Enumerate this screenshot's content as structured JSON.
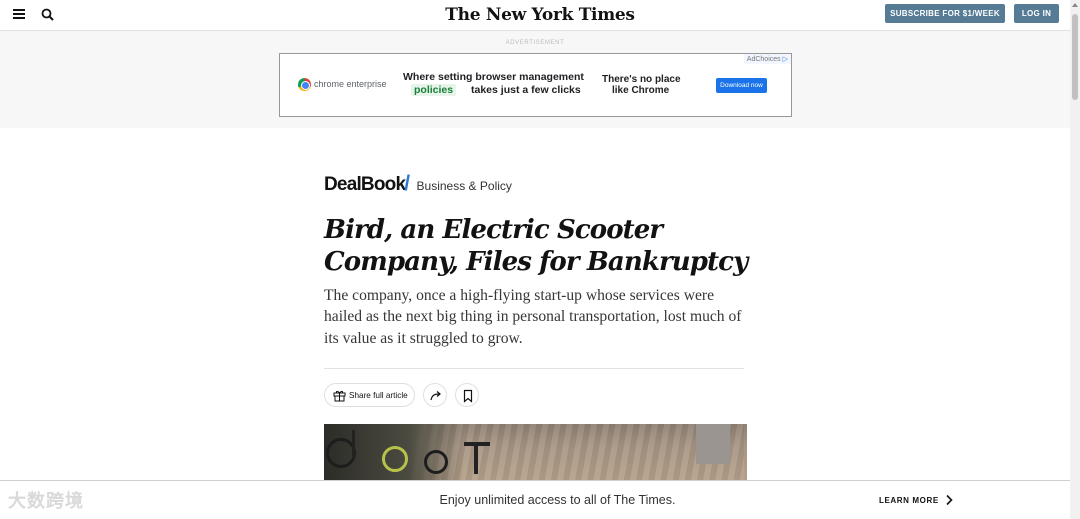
{
  "header": {
    "logo": "The New York Times",
    "subscribe_label": "SUBSCRIBE FOR $1/WEEK",
    "login_label": "LOG IN"
  },
  "ad": {
    "label": "ADVERTISEMENT",
    "adchoices": "AdChoices",
    "brand": "chrome enterprise",
    "headline_1": "Where setting browser management",
    "headline_highlight": "policies",
    "headline_2": "takes just a few clicks",
    "tagline_1": "There's no place",
    "tagline_2": "like Chrome",
    "cta": "Download now"
  },
  "article": {
    "column": "DealBook",
    "section": "Business & Policy",
    "headline": "Bird, an Electric Scooter Company, Files for Bankruptcy",
    "summary": "The company, once a high-flying start-up whose services were hailed as the next big thing in personal transportation, lost much of its value as it struggled to grow.",
    "share_label": "Share full article"
  },
  "bottom_bar": {
    "watermark": "大数跨境",
    "promo_text": "Enjoy unlimited access to all of The Times.",
    "learn_more_label": "LEARN MORE"
  },
  "icons": [
    "menu-icon",
    "search-icon",
    "gift-icon",
    "share-icon",
    "bookmark-icon",
    "chevron-right-icon"
  ],
  "colors": {
    "button_blue": "#567b95",
    "dealbook_accent": "#2b7bd6",
    "ad_cta": "#1a73e8"
  }
}
